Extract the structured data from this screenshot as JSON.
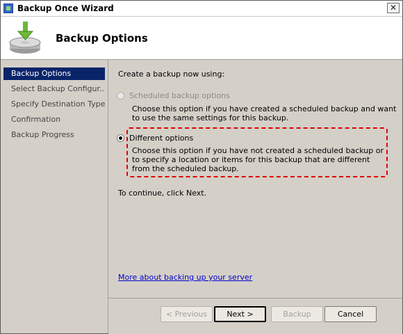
{
  "window": {
    "title": "Backup Once Wizard",
    "close_glyph": "✕"
  },
  "header": {
    "title": "Backup Options",
    "icon": "backup-disk-icon"
  },
  "nav": {
    "items": [
      {
        "label": "Backup Options",
        "selected": true
      },
      {
        "label": "Select Backup Configur...",
        "selected": false
      },
      {
        "label": "Specify Destination Type",
        "selected": false
      },
      {
        "label": "Confirmation",
        "selected": false
      },
      {
        "label": "Backup Progress",
        "selected": false
      }
    ]
  },
  "main": {
    "intro": "Create a backup now using:",
    "options": [
      {
        "label": "Scheduled backup options",
        "enabled": false,
        "checked": false,
        "description": "Choose this option if you have created a scheduled backup and want to use the same settings for this backup."
      },
      {
        "label": "Different options",
        "enabled": true,
        "checked": true,
        "description": "Choose this option if you have not created a scheduled backup or to specify a location or items for this backup that are different from the scheduled backup."
      }
    ],
    "continue_text": "To continue, click Next.",
    "help_link": "More about backing up your server",
    "highlight_color": "#e00000"
  },
  "buttons": {
    "previous": "< Previous",
    "next": "Next >",
    "backup": "Backup",
    "cancel": "Cancel"
  }
}
